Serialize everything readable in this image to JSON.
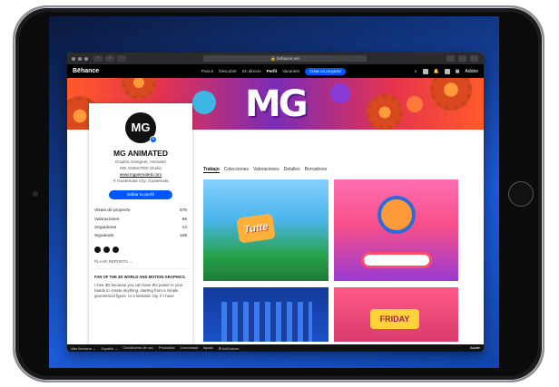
{
  "browser": {
    "url": "behance.net"
  },
  "nav": {
    "logo": "Bēhance",
    "links": [
      "Para ti",
      "Descubrir",
      "En directo",
      "Perfil",
      "Vacantes"
    ],
    "active": "Perfil",
    "cta": "Crear un proyecto",
    "adobe": "Adobe"
  },
  "banner": {
    "logo_text": "MG"
  },
  "profile": {
    "avatar_text": "MG",
    "name": "MG ANIMATED",
    "role": "Graphic Designer, Animator",
    "studio": "MG ANIMATED Studio",
    "website": "www.mganimated.com",
    "location": "Guatemala City, Guatemala",
    "edit_button": "Editar tu perfil",
    "stats": [
      {
        "label": "Vistas de proyecto",
        "value": "576"
      },
      {
        "label": "Valoraciones",
        "value": "56"
      },
      {
        "label": "Seguidores",
        "value": "12"
      },
      {
        "label": "Siguiendo",
        "value": "108"
      }
    ],
    "reports": "PLAAR REPORTS →",
    "about_heading": "FAN OF THE 3D WORLD AND MOTION GRAPHICS.",
    "about_text": "I love 3D because you can have the power in your hands to create anything, starting from a simple geometrical figure, to a fantastic city. If I have"
  },
  "tabs": [
    "Trabajo",
    "Colecciones",
    "Valoraciones",
    "Detalles",
    "Borradores"
  ],
  "active_tab": "Trabajo",
  "thumbs": {
    "t1_sign": "Tutte",
    "t4_sign": "FRIDAY"
  },
  "footer": {
    "items": [
      "Más Behance ⌄",
      "Español ⌄",
      "Condiciones de uso",
      "Privacidad",
      "Comunidad",
      "Ayuda",
      "⚙ AdChoices"
    ],
    "adobe": "Adobe"
  }
}
